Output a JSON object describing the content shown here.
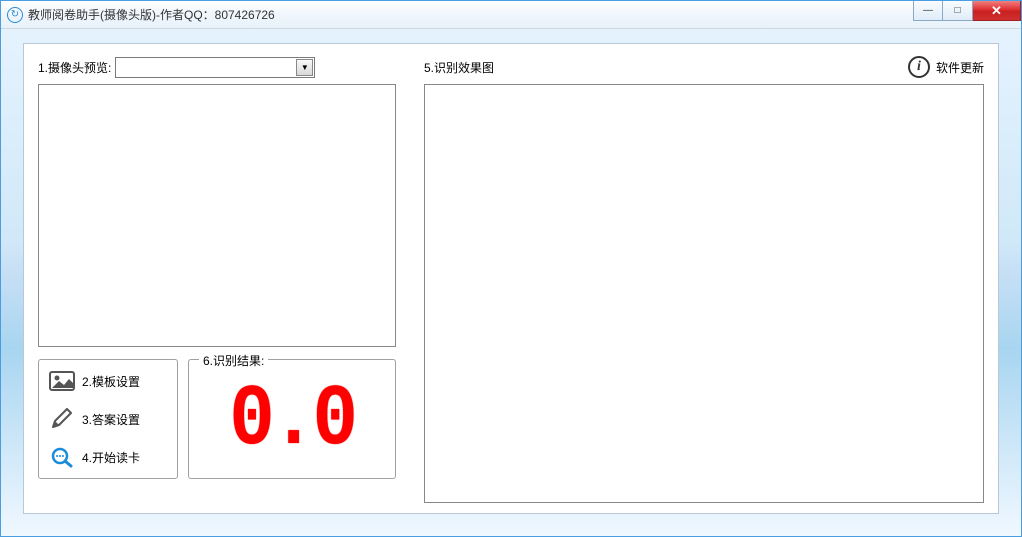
{
  "window": {
    "title": "教师阅卷助手(摄像头版)-作者QQ：807426726"
  },
  "labels": {
    "camera_preview": "1.摄像头预览:",
    "template_setup": "2.模板设置",
    "answer_setup": "3.答案设置",
    "start_read": "4.开始读卡",
    "effect_image": "5.识别效果图",
    "result_group": "6.识别结果:",
    "software_update": "软件更新"
  },
  "result": {
    "value": "0.0"
  },
  "icons": {
    "app": "↻",
    "template": "image-icon",
    "answer": "pencil-icon",
    "start": "magnifier-icon",
    "info": "i",
    "min": "—",
    "max": "□",
    "close": "✕",
    "dropdown": "▼"
  }
}
